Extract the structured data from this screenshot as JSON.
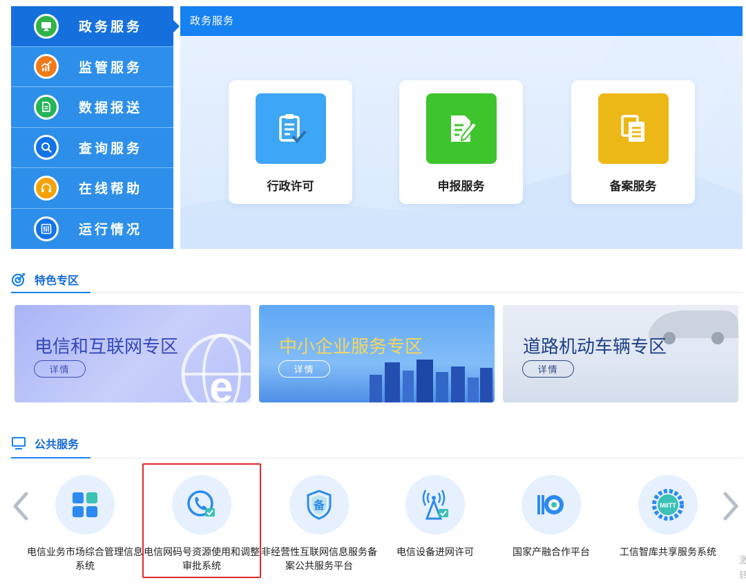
{
  "nav": {
    "items": [
      {
        "label": "政务服务",
        "icon": "monitor-icon",
        "color": "#2fb34a",
        "active": true
      },
      {
        "label": "监管服务",
        "icon": "chart-up-icon",
        "color": "#f07a18",
        "active": false
      },
      {
        "label": "数据报送",
        "icon": "document-send-icon",
        "color": "#26b35a",
        "active": false
      },
      {
        "label": "查询服务",
        "icon": "search-icon",
        "color": "#1273e6",
        "active": false
      },
      {
        "label": "在线帮助",
        "icon": "headset-icon",
        "color": "#f5a20a",
        "active": false
      },
      {
        "label": "运行情况",
        "icon": "sliders-icon",
        "color": "#1273e6",
        "active": false
      }
    ]
  },
  "panel": {
    "title": "政务服务",
    "cards": [
      {
        "label": "行政许可",
        "icon": "clipboard-check-icon",
        "color": "#3da6f5"
      },
      {
        "label": "申报服务",
        "icon": "document-edit-icon",
        "color": "#3ec42c"
      },
      {
        "label": "备案服务",
        "icon": "copy-document-icon",
        "color": "#ecb817"
      }
    ]
  },
  "featured": {
    "title": "特色专区",
    "icon": "target-icon",
    "banners": [
      {
        "title": "电信和互联网专区",
        "button": "详情"
      },
      {
        "title": "中小企业服务专区",
        "button": "详情"
      },
      {
        "title": "道路机动车辆专区",
        "button": "详情"
      }
    ]
  },
  "public_services": {
    "title": "公共服务",
    "icon": "monitor-icon",
    "items": [
      {
        "label": "电信业务市场综合管理信息系统",
        "icon": "grid-apps-icon"
      },
      {
        "label": "电信网码号资源使用和调整审批系统",
        "icon": "phone-check-icon"
      },
      {
        "label": "非经营性互联网信息服务备案公共服务平台",
        "icon": "shield-bei-icon"
      },
      {
        "label": "电信设备进网许可",
        "icon": "antenna-tower-icon"
      },
      {
        "label": "国家产融合作平台",
        "icon": "target-speed-icon"
      },
      {
        "label": "工信智库共享服务系统",
        "icon": "miit-gear-icon",
        "badge": "MIITT"
      }
    ],
    "prev": "chevron-left-icon",
    "next": "chevron-right-icon"
  },
  "edge_text": [
    "激",
    "转"
  ]
}
